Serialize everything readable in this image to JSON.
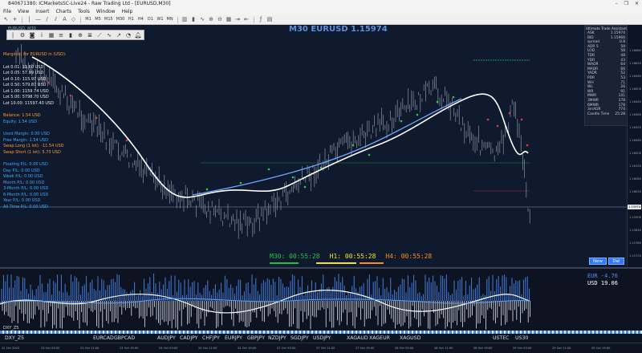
{
  "window": {
    "title": "840671380: ICMarketsSC-Live24 - Raw Trading Ltd - [EURUSD,M30]",
    "controls": [
      "–",
      "❐",
      "✕"
    ]
  },
  "menu": [
    "File",
    "View",
    "Insert",
    "Charts",
    "Tools",
    "Window",
    "Help"
  ],
  "toolbar": {
    "timeframes": [
      "M1",
      "M5",
      "M15",
      "M30",
      "H1",
      "H4",
      "D1",
      "W1",
      "MN"
    ]
  },
  "chart": {
    "symbol_label": "EURUSD, M30",
    "title": "M30 EURUSD 1.15974",
    "drawing_tools": [
      "pointer",
      "crosshair",
      "vline",
      "hline",
      "trend",
      "channel",
      "fibo",
      "text",
      "arrow"
    ]
  },
  "info_panel": {
    "margin_header": "Margin(s) for EURUSD in (USD):",
    "lots": [
      "Lot 0.01: 11.60 USD",
      "Lot 0.05: 57.99 USD",
      "Lot 0.10: 115.97 USD",
      "Lot 0.50: 579.87 USD",
      "Lot 1.00: 1159.74 USD",
      "Lot 5.00: 5798.70 USD",
      "Lot 10.00: 11597.40 USD"
    ],
    "balance": "Balance: 1.54 USD",
    "equity": "Equity: 1.54 USD",
    "used_margin": "Used Margin: 0.00 USD",
    "free_margin": "Free Margin: 1.54 USD",
    "swap_long": "Swap Long (1 lot): -11.54 USD",
    "swap_short": "Swap Short (1 lot): 5.73 USD",
    "pl": [
      "Floating P/L: 0.00 USD",
      "Day P/L: 0.00 USD",
      "Week P/L: 0.00 USD",
      "Month P/L: 0.00 USD",
      "3-Month P/L: 0.00 USD",
      "6-Month P/L: 0.00 USD",
      "Year P/L: 0.00 USD",
      "All Time P/L: 0.00 USD"
    ]
  },
  "assistant": {
    "title": "Ultimate Trade Assistant",
    "rows": [
      {
        "k": "ASK",
        "v": "1.15974"
      },
      {
        "k": "BID",
        "v": "1.15966"
      },
      {
        "k": "spread",
        "v": "0.8"
      },
      {
        "k": "ADR 5",
        "v": "59"
      },
      {
        "k": "LOD",
        "v": "58"
      },
      {
        "k": "TDR",
        "v": "48"
      },
      {
        "k": "YDR",
        "v": "43"
      },
      {
        "k": "WADR",
        "v": "64"
      },
      {
        "k": "MADR",
        "v": "66"
      },
      {
        "k": "YADR",
        "v": "52"
      },
      {
        "k": "PDR",
        "v": "53"
      },
      {
        "k": "WH",
        "v": "71"
      },
      {
        "k": "WL",
        "v": "26"
      },
      {
        "k": "WR",
        "v": "91"
      },
      {
        "k": "MWR",
        "v": "141"
      },
      {
        "k": "3MWR",
        "v": "178"
      },
      {
        "k": "6MWR",
        "v": "178"
      },
      {
        "k": "3mADR",
        "v": "774"
      },
      {
        "k": "Candle Time",
        "v": "25:28"
      }
    ]
  },
  "price_axis": {
    "labels": [
      "1.16680",
      "1.16620",
      "1.16560",
      "1.16500",
      "1.16440",
      "1.16380",
      "1.16320",
      "1.16260",
      "1.16200",
      "1.16140",
      "1.16080",
      "1.16020",
      "1.15974",
      "1.15900",
      "1.15840",
      "1.15780",
      "1.15720"
    ],
    "current": "1.15974"
  },
  "timers": {
    "m30": "M30: 00:55:28",
    "h1": "H1: 00:55:28",
    "h4": "H4: 00:55:28"
  },
  "buttons": {
    "new": "New",
    "del": "Del"
  },
  "subchart": {
    "label_left": "DXY_Z5",
    "eur": "EUR -4.76",
    "usd": "USD 19.06"
  },
  "currency_row": [
    "DXY_Z5",
    "EURCAD",
    "GBPCAD",
    "AUDJPY",
    "CADJPY",
    "CHFJPY",
    "EURJPY",
    "GBPJPY",
    "NZDJPY",
    "SGDJPY",
    "USDJPY",
    "XAGAUD",
    "XAGEUR",
    "XAGUSD",
    "USTEC",
    "US30"
  ],
  "time_axis": [
    "22 Oct 2025",
    "23 Oct 03:00",
    "23 Oct 11:00",
    "23 Oct 19:00",
    "24 Oct 03:00",
    "24 Oct 11:00",
    "24 Oct 19:00",
    "27 Oct 03:00",
    "27 Oct 11:00",
    "27 Oct 19:00",
    "28 Oct 03:00",
    "28 Oct 11:00",
    "28 Oct 19:00",
    "29 Oct 03:00",
    "29 Oct 11:00",
    "29 Oct 19:00"
  ]
}
